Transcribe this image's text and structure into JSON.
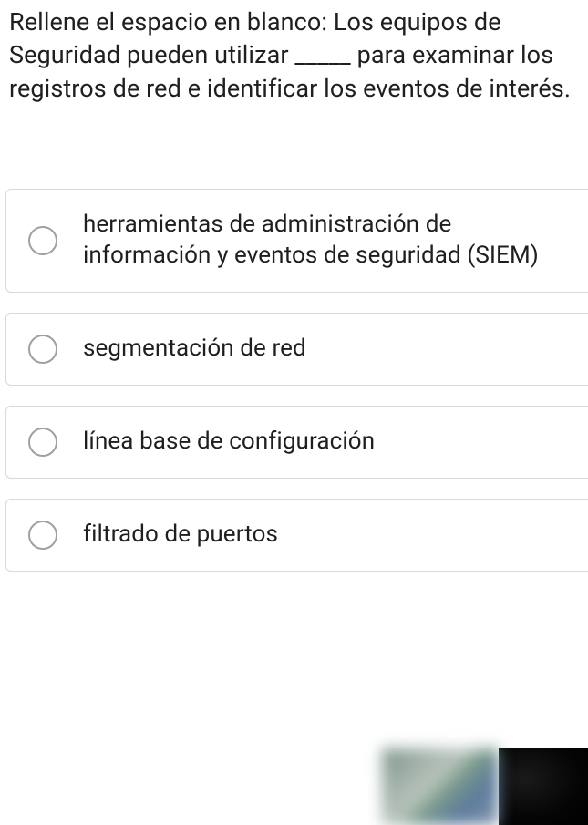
{
  "question": {
    "text": "Rellene el espacio en blanco: Los equipos de Seguridad pueden utilizar _____ para examinar los registros de red e identificar los eventos de interés."
  },
  "options": [
    {
      "label": "herramientas de administración de información y eventos de seguridad (SIEM)"
    },
    {
      "label": "segmentación de red"
    },
    {
      "label": "línea base de configuración"
    },
    {
      "label": "filtrado de puertos"
    }
  ]
}
